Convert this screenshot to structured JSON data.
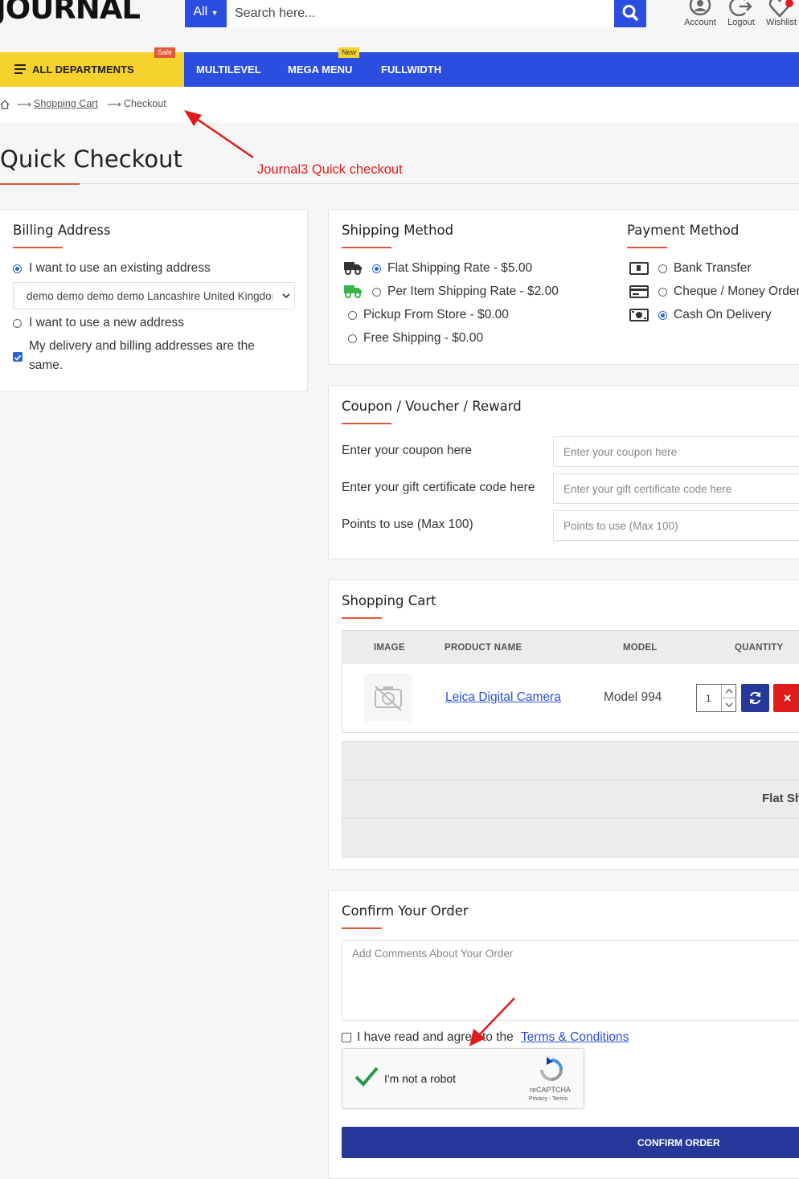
{
  "header": {
    "logo_text": "JOURNAL",
    "search": {
      "category": "All",
      "placeholder": "Search here..."
    },
    "icons": [
      {
        "label": "Account",
        "icon": "account-icon"
      },
      {
        "label": "Logout",
        "icon": "logout-icon"
      },
      {
        "label": "Wishlist",
        "icon": "heart-icon"
      }
    ]
  },
  "nav": {
    "departments_label": "ALL DEPARTMENTS",
    "departments_badge": "Sale",
    "items": [
      {
        "label": "MULTILEVEL",
        "badge": ""
      },
      {
        "label": "MEGA MENU",
        "badge": "New"
      },
      {
        "label": "FULLWIDTH",
        "badge": ""
      }
    ]
  },
  "breadcrumb": {
    "home_icon": "home-icon",
    "items": [
      "Shopping Cart",
      "Checkout"
    ]
  },
  "page": {
    "title": "Quick Checkout",
    "annotation": "Journal3 Quick checkout"
  },
  "billing": {
    "title": "Billing Address",
    "existing_label": "I want to use an existing address",
    "existing_selected": true,
    "address_value": "demo demo demo demo Lancashire United Kingdom",
    "new_label": "I want to use a new address",
    "same_label_line1": "My delivery and billing addresses are the",
    "same_label_line2": "same.",
    "same_checked": true
  },
  "shipping": {
    "title": "Shipping Method",
    "options": [
      {
        "label": "Flat Shipping Rate - $5.00",
        "selected": true,
        "icon": "truck-icon"
      },
      {
        "label": "Per Item Shipping Rate - $2.00",
        "selected": false,
        "icon": "green-truck-icon"
      },
      {
        "label": "Pickup From Store - $0.00",
        "selected": false
      },
      {
        "label": "Free Shipping - $0.00",
        "selected": false
      }
    ]
  },
  "payment": {
    "title": "Payment Method",
    "options": [
      {
        "label": "Bank Transfer",
        "selected": false,
        "icon": "bank-transfer-icon"
      },
      {
        "label": "Cheque / Money Order",
        "selected": false,
        "icon": "card-icon"
      },
      {
        "label": "Cash On Delivery",
        "selected": true,
        "icon": "cash-icon"
      }
    ]
  },
  "coupon": {
    "title": "Coupon / Voucher / Reward",
    "rows": [
      {
        "label": "Enter your coupon here",
        "placeholder": "Enter your coupon here"
      },
      {
        "label": "Enter your gift certificate code here",
        "placeholder": "Enter your gift certificate code here"
      },
      {
        "label": "Points to use (Max 100)",
        "placeholder": "Points to use (Max 100)"
      }
    ]
  },
  "cart": {
    "title": "Shopping Cart",
    "headers": [
      "IMAGE",
      "PRODUCT NAME",
      "MODEL",
      "QUANTITY"
    ],
    "rows": [
      {
        "product": "Leica Digital Camera",
        "model": "Model 994",
        "quantity": "1"
      }
    ],
    "totals_partial_label": "Flat Sh"
  },
  "confirm": {
    "title": "Confirm Your Order",
    "comments_placeholder": "Add Comments About Your Order",
    "terms_prefix": "I have read and agree to the",
    "terms_link": "Terms & Conditions",
    "captcha_label": "I'm not a robot",
    "captcha_brand": "reCAPTCHA",
    "captcha_links": "Privacy - Terms",
    "button_label": "CONFIRM ORDER"
  },
  "colors": {
    "brand_blue": "#2c4ee0",
    "dept_yellow": "#f6d22c",
    "accent_orange": "#e0573a",
    "annotation_red": "#e01b1b",
    "confirm_button": "#26399a",
    "remove_red": "#e01b1b"
  }
}
